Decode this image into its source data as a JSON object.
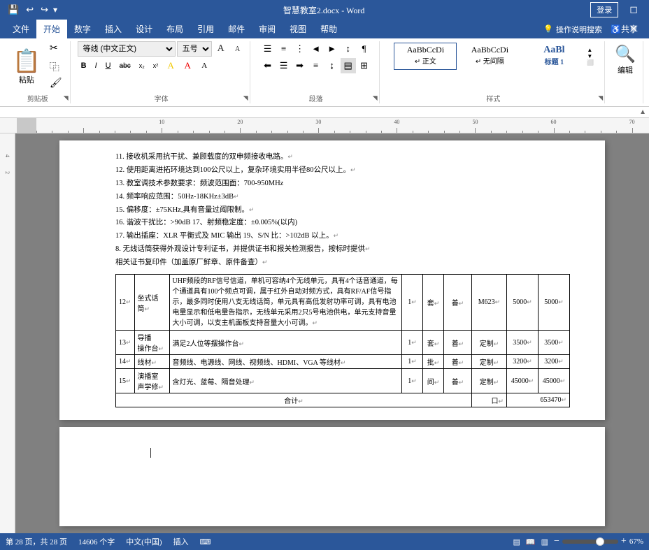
{
  "titleBar": {
    "title": "智慧教室2.docx - Word",
    "loginBtn": "登录",
    "saveIcon": "💾",
    "undoIcon": "↩",
    "redoIcon": "↪",
    "quickAccessArrow": "▾"
  },
  "ribbonTabs": [
    "文件",
    "开始",
    "数字",
    "插入",
    "设计",
    "布局",
    "引用",
    "邮件",
    "审阅",
    "视图",
    "帮助"
  ],
  "activeTab": "开始",
  "ribbon": {
    "clipboard": {
      "label": "剪贴板",
      "paste": "粘贴",
      "cut": "✂",
      "copy": "⿻",
      "formatPainter": "🖌"
    },
    "font": {
      "label": "字体",
      "fontName": "等线 (中文正文)",
      "fontSize": "五号",
      "bold": "B",
      "italic": "I",
      "underline": "U",
      "strikethrough": "abc",
      "subscript": "x₂",
      "superscript": "x²"
    },
    "paragraph": {
      "label": "段落"
    },
    "styles": {
      "label": "样式",
      "items": [
        "正文",
        "无间隔",
        "标题 1"
      ]
    },
    "editing": {
      "label": "编辑",
      "icon": "🔍"
    }
  },
  "toolbar": {
    "lightbulb": "💡",
    "operationSearch": "操作说明搜索",
    "share": "♿共享"
  },
  "tableData": {
    "rows": [
      {
        "num": "12",
        "name": "坐式话筒",
        "spec": "UHF频段的RF信号信道，单机可容纳4个无线单元，具有4个话音通道，每个通道具有100个频点可调，属于红外自动对频方式，具有RF/AF信号指示，最多同时使用八支无线话筒，单元具有高低发射功率可调，具有电池电量显示和低电量告指示，无线单元采用2只5号电池供电，单元支持音量大小可调，以支主机面板支持音量大小可调。",
        "qty": "1",
        "unit": "套",
        "brand": "善",
        "model": "M623",
        "price": "5000",
        "total": "5000"
      },
      {
        "num": "13",
        "name": "导播操作台",
        "spec": "满足2人位等摆操作台",
        "qty": "1",
        "unit": "套",
        "brand": "善",
        "model": "定制",
        "price": "3500",
        "total": "3500"
      },
      {
        "num": "14",
        "name": "线材",
        "spec": "音频线、电源线、网线、视频线、HDMI、VGA 等线材",
        "qty": "1",
        "unit": "批",
        "brand": "善",
        "model": "定制",
        "price": "3200",
        "total": "3200"
      },
      {
        "num": "15",
        "name": "演播室声学修",
        "spec": "含灯光、蓝莓、隔音处理",
        "qty": "1",
        "unit": "间",
        "brand": "善",
        "model": "定制",
        "price": "45000",
        "total": "45000"
      }
    ],
    "totalLabel": "合计",
    "totalValue": "口",
    "totalAmount": "653470"
  },
  "aboveTableText": [
    "11. 接收机采用抗干扰、兼顾载度的双申频接收电路。",
    "12. 使用距离进拓环境达到100公尺以上，复杂环境实用半径80公尺以上。",
    "13. 教室调技术参数要求：频波范围面：700-950MHz",
    "14. 频率响应范围：50Hz-18KHz±3dB",
    "15. 偏移度：±75KHz,具有音量过阈限制。",
    "16. 谐波干扰比：>90dB 17、射频稳定度：±0.005%(以内)",
    "17. 输出插座：XLR 平衡式及 MIC 输出 19、S/N 比：>102dB 以上。",
    "8. 无线话筒获得外观设计专利证书，并提供证书和报关检测报告，按标时提供相关证书复印件（加盖原厂鲜章、原件备查）"
  ],
  "statusBar": {
    "pageInfo": "第 28 页，共 28 页",
    "wordCount": "14606 个字",
    "language": "中文(中国)",
    "mode": "插入",
    "zoom": "67%",
    "zoomMinus": "−",
    "zoomPlus": "+"
  }
}
